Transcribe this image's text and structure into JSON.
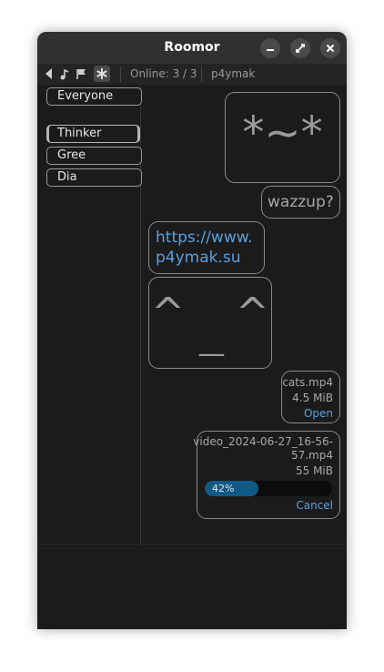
{
  "window": {
    "title": "Roomor"
  },
  "toolbar": {
    "online_text": "Online: 3 / 3",
    "username": "p4ymak"
  },
  "sidebar": {
    "items": [
      {
        "label": "Everyone",
        "selected": false
      },
      {
        "label": "Thinker",
        "selected": true
      },
      {
        "label": "Gree",
        "selected": false
      },
      {
        "label": "Dia",
        "selected": false
      }
    ]
  },
  "messages": {
    "emoticon1": "*~*",
    "text1": "wazzup?",
    "link_line1": "https://www.",
    "link_line2": "p4ymak.su",
    "emoticon2_eyes": "^    ^",
    "emoticon2_mouth": "__",
    "file1": {
      "name": "cats.mp4",
      "size": "4.5 MiB",
      "action": "Open"
    },
    "file2": {
      "name_line1": "video_2024-06-27_16-56-",
      "name_line2": "57.mp4",
      "size": "55 MiB",
      "progress_label": "42%",
      "progress_fraction": 0.42,
      "action": "Cancel"
    }
  },
  "colors": {
    "accent": "#5aa0e0",
    "progress": "#0f5a85",
    "background": "#1b1b1b"
  }
}
